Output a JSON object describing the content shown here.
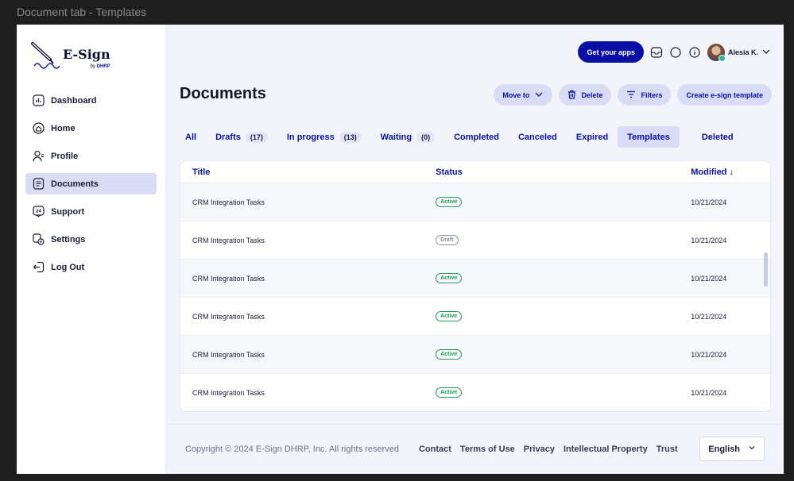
{
  "window": {
    "title": "Document tab - Templates"
  },
  "brand": {
    "name": "E-Sign",
    "by": "by",
    "company": "DHRP"
  },
  "sidebar": {
    "items": [
      {
        "label": "Dashboard",
        "icon": "dashboard-icon"
      },
      {
        "label": "Home",
        "icon": "home-icon"
      },
      {
        "label": "Profile",
        "icon": "profile-icon"
      },
      {
        "label": "Documents",
        "icon": "documents-icon",
        "active": true
      },
      {
        "label": "Support",
        "icon": "support-icon"
      },
      {
        "label": "Settings",
        "icon": "settings-icon"
      },
      {
        "label": "Log Out",
        "icon": "logout-icon"
      }
    ]
  },
  "topbar": {
    "apps_label": "Get your apps",
    "user_name": "Alesia K."
  },
  "page": {
    "title": "Documents"
  },
  "actions": {
    "move_to": "Move to",
    "delete": "Delete",
    "filters": "Filters",
    "create": "Create e-sign template"
  },
  "tabs": [
    {
      "label": "All"
    },
    {
      "label": "Drafts",
      "count": "(17)"
    },
    {
      "label": "In progress",
      "count": "(13)"
    },
    {
      "label": "Waiting",
      "count": "(0)"
    },
    {
      "label": "Completed"
    },
    {
      "label": "Canceled"
    },
    {
      "label": "Expired"
    },
    {
      "label": "Templates",
      "active": true
    },
    {
      "label": "Deleted"
    }
  ],
  "table": {
    "columns": {
      "title": "Title",
      "status": "Status",
      "modified": "Modified"
    },
    "rows": [
      {
        "title": "CRM Integration Tasks",
        "status": "Active",
        "modified": "10/21/2024"
      },
      {
        "title": "CRM Integration Tasks",
        "status": "Draft",
        "modified": "10/21/2024"
      },
      {
        "title": "CRM Integration Tasks",
        "status": "Active",
        "modified": "10/21/2024"
      },
      {
        "title": "CRM Integration Tasks",
        "status": "Active",
        "modified": "10/21/2024"
      },
      {
        "title": "CRM Integration Tasks",
        "status": "Active",
        "modified": "10/21/2024"
      },
      {
        "title": "CRM Integration Tasks",
        "status": "Active",
        "modified": "10/21/2024"
      }
    ]
  },
  "footer": {
    "copyright": "Copyright © 2024 E-Sign DHRP, Inc. All rights reserved",
    "links": [
      "Contact",
      "Terms of Use",
      "Privacy",
      "Intellectual Property",
      "Trust"
    ],
    "language": "English"
  },
  "colors": {
    "accent": "#0a0fa5",
    "active_bg": "#d9dcf5",
    "status_active": "#1e9a55",
    "status_draft": "#8b8fa3"
  }
}
